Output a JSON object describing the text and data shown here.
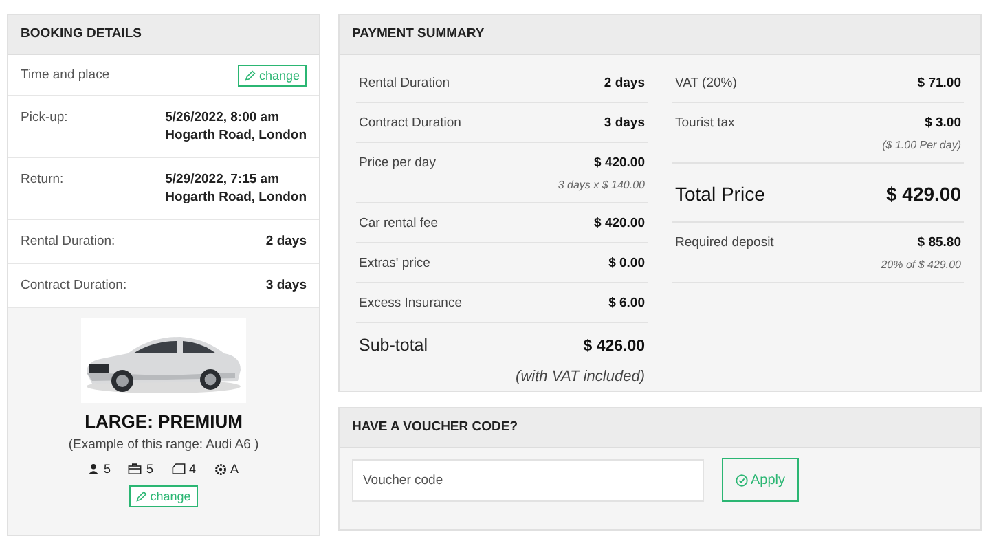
{
  "booking": {
    "title": "BOOKING DETAILS",
    "time_place": {
      "label": "Time and place",
      "button": "change"
    },
    "rows": [
      {
        "label": "Pick-up:",
        "value": [
          "5/26/2022, 8:00 am",
          "Hogarth Road, London"
        ]
      },
      {
        "label": "Return:",
        "value": [
          "5/29/2022, 7:15 am",
          "Hogarth Road, London"
        ]
      },
      {
        "label": "Rental Duration:",
        "value": [
          "2 days"
        ]
      },
      {
        "label": "Contract Duration:",
        "value": [
          "3 days"
        ]
      }
    ],
    "car": {
      "kind": "picture",
      "name": "LARGE: PREMIUM",
      "example": "(Example of this range: Audi A6 )",
      "specs": [
        {
          "kind": "seats",
          "value": "5"
        },
        {
          "kind": "bags",
          "value": "5"
        },
        {
          "kind": "doors",
          "value": "4"
        },
        {
          "kind": "transmission",
          "value": "A"
        }
      ],
      "button": "change"
    }
  },
  "payment": {
    "title": "PAYMENT SUMMARY",
    "left": [
      {
        "kind": "line",
        "label": "Rental Duration",
        "value": "2 days"
      },
      {
        "kind": "line",
        "label": "Contract Duration",
        "value": "3 days"
      },
      {
        "kind": "line",
        "label": "Price per day",
        "value": "$ 420.00",
        "note": "3 days x $ 140.00"
      },
      {
        "kind": "line",
        "label": "Car rental fee",
        "value": "$ 420.00"
      },
      {
        "kind": "line",
        "label": "Extras' price",
        "value": "$ 0.00"
      },
      {
        "kind": "line",
        "label": "Excess Insurance",
        "value": "$ 6.00"
      },
      {
        "kind": "subtotal",
        "label": "Sub-total",
        "value": "$ 426.00",
        "note": "(with VAT included)"
      }
    ],
    "right": [
      {
        "kind": "line",
        "label": "VAT (20%)",
        "value": "$ 71.00"
      },
      {
        "kind": "line",
        "label": "Tourist tax",
        "value": "$ 3.00",
        "note": "($ 1.00 Per day)"
      },
      {
        "kind": "total",
        "label": "Total Price",
        "value": "$ 429.00"
      },
      {
        "kind": "line",
        "label": "Required deposit",
        "value": "$ 85.80",
        "note": "20% of $ 429.00"
      }
    ]
  },
  "voucher": {
    "title": "HAVE A VOUCHER CODE?",
    "placeholder": "Voucher code",
    "button": "Apply"
  }
}
